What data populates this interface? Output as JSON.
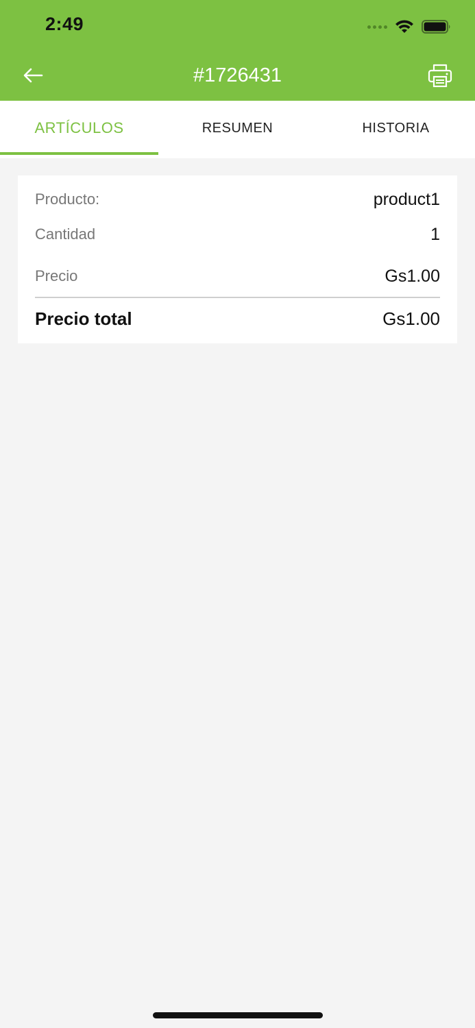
{
  "status_bar": {
    "time": "2:49"
  },
  "header": {
    "title": "#1726431"
  },
  "tabs": [
    {
      "label": "ARTÍCULOS",
      "active": true
    },
    {
      "label": "RESUMEN",
      "active": false
    },
    {
      "label": "HISTORIA",
      "active": false
    }
  ],
  "item": {
    "product_label": "Producto:",
    "product_value": "product1",
    "quantity_label": "Cantidad",
    "quantity_value": "1",
    "price_label": "Precio",
    "price_value": "Gs1.00",
    "total_label": "Precio total",
    "total_value": "Gs1.00"
  },
  "colors": {
    "accent": "#7dc142",
    "background": "#f4f4f4"
  },
  "icons": {
    "back": "arrow-left-icon",
    "print": "printer-icon"
  }
}
